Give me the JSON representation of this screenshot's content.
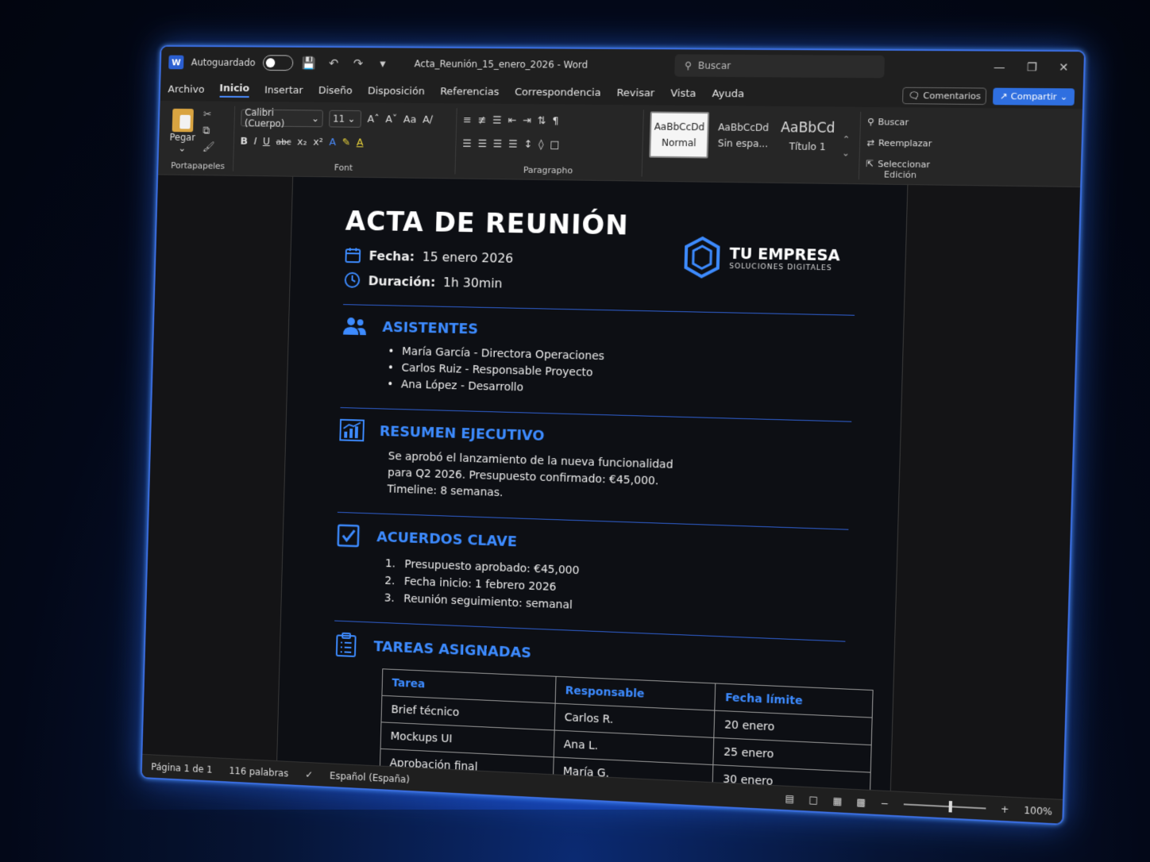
{
  "titlebar": {
    "app_logo": "W",
    "autosave_label": "Autoguardado",
    "autosave_on": false,
    "doc_title": "Acta_Reunión_15_enero_2026",
    "app_name": "Word",
    "search_placeholder": "Buscar"
  },
  "menu": {
    "tabs": [
      "Archivo",
      "Inicio",
      "Insertar",
      "Diseño",
      "Disposición",
      "Referencias",
      "Correspondencia",
      "Revisar",
      "Vista",
      "Ayuda"
    ],
    "active_tab": "Inicio",
    "comments_label": "Comentarios",
    "share_label": "Compartir"
  },
  "ribbon": {
    "clipboard": {
      "paste_label": "Pegar",
      "group_label": "Portapapeles"
    },
    "font": {
      "font_name": "Calibri (Cuerpo)",
      "font_size": "11",
      "group_label": "Font"
    },
    "paragraph": {
      "group_label": "Paragrapho"
    },
    "styles": [
      {
        "sample": "AaBbCcDd",
        "name": "Normal",
        "active": true
      },
      {
        "sample": "AaBbCcDd",
        "name": "Sin espa...",
        "active": false
      },
      {
        "sample": "AaBbCd",
        "name": "Título 1",
        "active": false
      }
    ],
    "editing": {
      "find_label": "Buscar",
      "replace_label": "Reemplazar",
      "select_label": "Seleccionar",
      "group_label": "Edición"
    }
  },
  "document": {
    "title": "ACTA DE REUNIÓN",
    "date_label": "Fecha:",
    "date_value": "15 enero 2026",
    "duration_label": "Duración:",
    "duration_value": "1h 30min",
    "brand_name": "TU EMPRESA",
    "brand_sub": "SOLUCIONES DIGITALES",
    "attendees_title": "ASISTENTES",
    "attendees": [
      "María García - Directora Operaciones",
      "Carlos Ruiz - Responsable Proyecto",
      "Ana López - Desarrollo"
    ],
    "summary_title": "RESUMEN EJECUTIVO",
    "summary_lines": [
      "Se aprobó el lanzamiento de la nueva funcionalidad",
      "para Q2 2026. Presupuesto confirmado: €45,000.",
      "Timeline: 8 semanas."
    ],
    "agreements_title": "ACUERDOS CLAVE",
    "agreements": [
      {
        "num": "1.",
        "text": "Presupuesto aprobado: €45,000"
      },
      {
        "num": "2.",
        "text": "Fecha inicio: 1 febrero 2026"
      },
      {
        "num": "3.",
        "text": "Reunión seguimiento: semanal"
      }
    ],
    "tasks_title": "TAREAS ASIGNADAS",
    "tasks_headers": [
      "Tarea",
      "Responsable",
      "Fecha límite"
    ],
    "tasks_rows": [
      [
        "Brief técnico",
        "Carlos R.",
        "20 enero"
      ],
      [
        "Mockups UI",
        "Ana L.",
        "25 enero"
      ],
      [
        "Aprobación final",
        "María G.",
        "30 enero"
      ]
    ]
  },
  "status": {
    "page": "Página 1 de 1",
    "words": "116 palabras",
    "language": "Español (España)",
    "zoom": "100%",
    "zoom_level": 0.55
  },
  "colors": {
    "accent": "#3d8bff",
    "share": "#2f6fe0",
    "border_glow": "#3a6de0"
  }
}
